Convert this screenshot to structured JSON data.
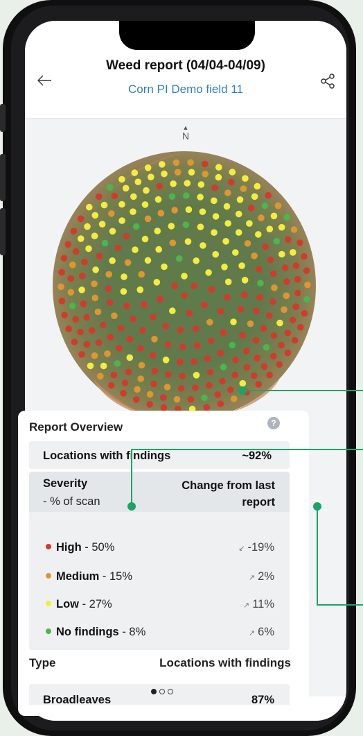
{
  "header": {
    "title": "Weed report (04/04-04/09)",
    "subtitle": "Corn PI Demo field 11"
  },
  "compass": {
    "label": "N"
  },
  "overview": {
    "title": "Report Overview",
    "help": "?",
    "locations": {
      "label": "Locations with findings",
      "value": "~92%"
    },
    "severity": {
      "label": "Severity",
      "sublabel": "- % of scan",
      "change_label": "Change from last report",
      "levels": [
        {
          "name": "High",
          "pct": " - 50%",
          "change": "-19%",
          "trend": "down",
          "color": "#d33a2c"
        },
        {
          "name": "Medium",
          "pct": " - 15%",
          "change": "2%",
          "trend": "up",
          "color": "#e0962e"
        },
        {
          "name": "Low",
          "pct": " - 27%",
          "change": "11%",
          "trend": "up",
          "color": "#f5ec3c"
        },
        {
          "name": "No findings",
          "pct": " - 8%",
          "change": "6%",
          "trend": "up",
          "color": "#4cb54c"
        }
      ]
    },
    "type": {
      "label": "Type",
      "column": "Locations with findings",
      "partial_row": {
        "label": "Broadleaves",
        "value": "87%"
      }
    }
  },
  "pager": {
    "total": 3,
    "active": 0
  },
  "colors": {
    "accent_link": "#2f7fc1",
    "callout": "#1aa566"
  }
}
